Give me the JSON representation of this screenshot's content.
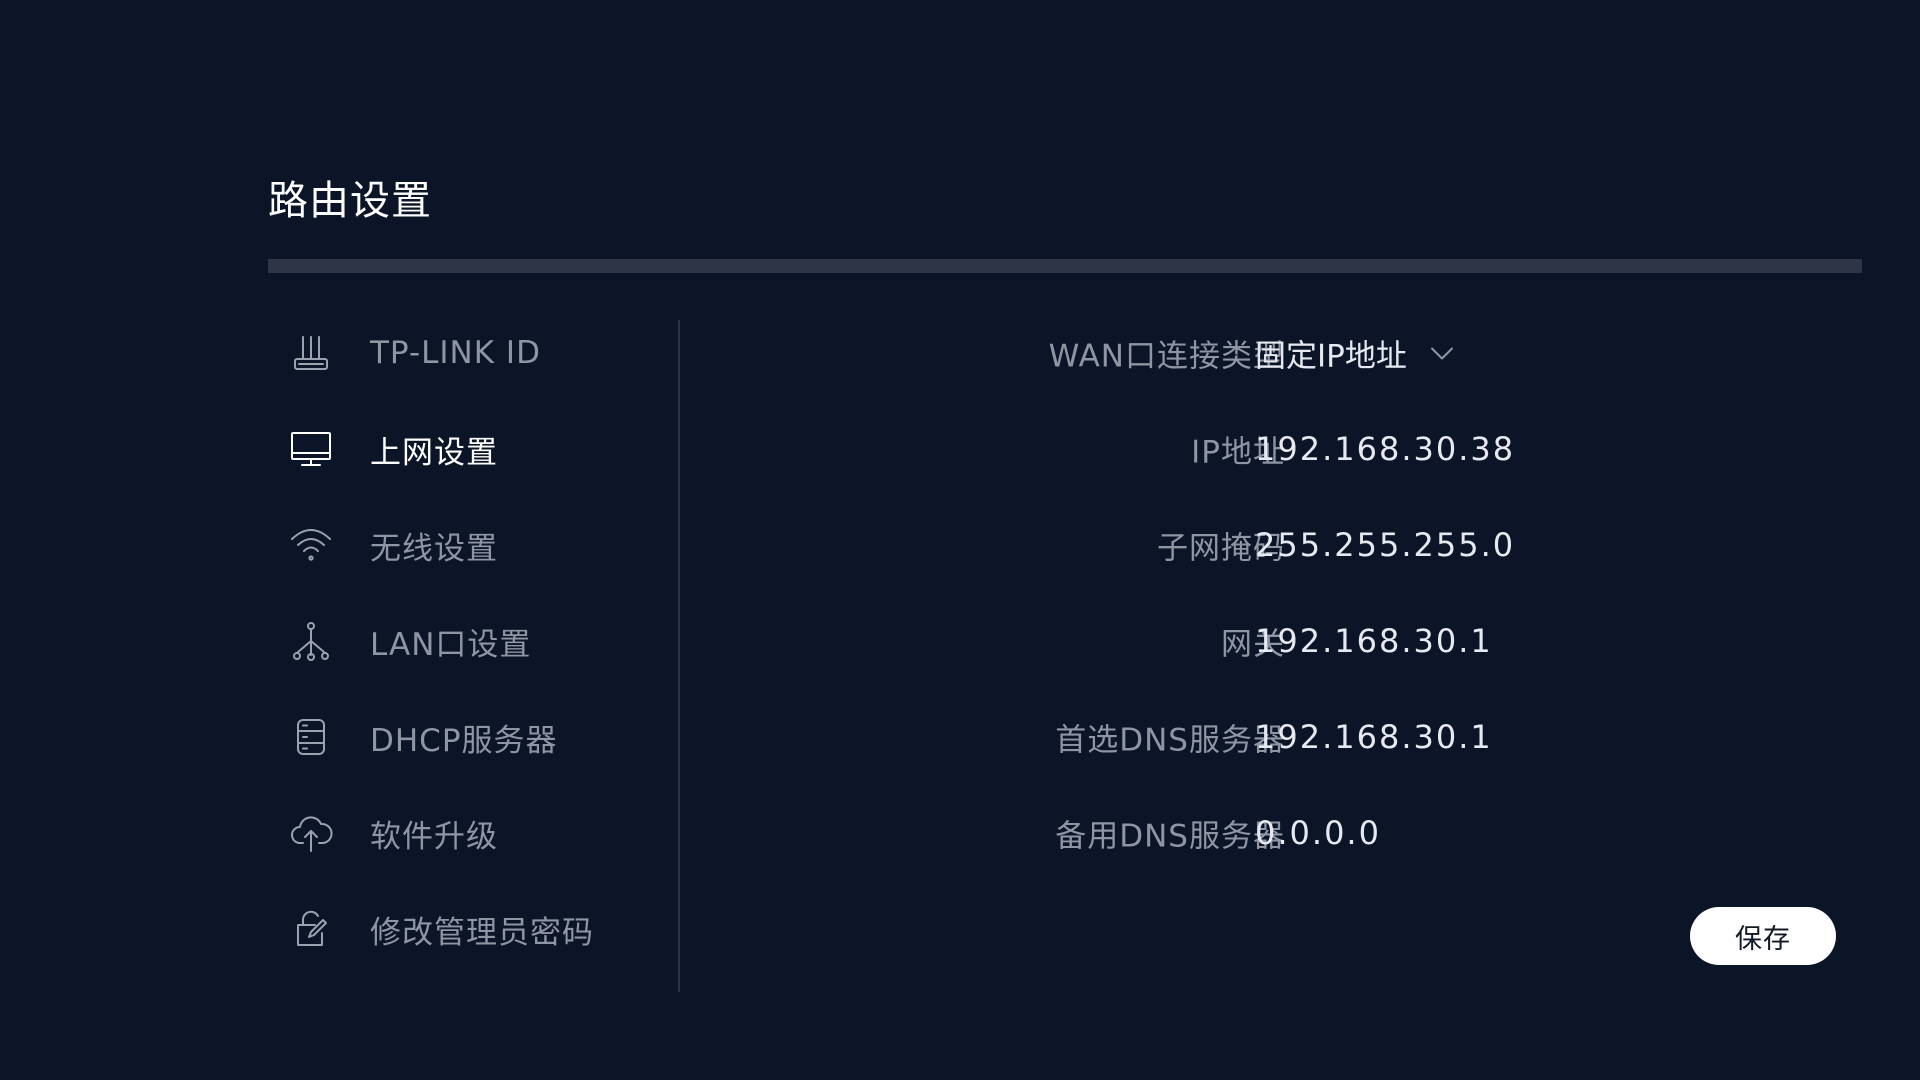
{
  "page": {
    "title": "路由设置"
  },
  "sidebar": {
    "items": [
      {
        "label": "TP-LINK ID",
        "icon": "router-icon",
        "active": false
      },
      {
        "label": "上网设置",
        "icon": "monitor-icon",
        "active": true
      },
      {
        "label": "无线设置",
        "icon": "wifi-icon",
        "active": false
      },
      {
        "label": "LAN口设置",
        "icon": "network-tree-icon",
        "active": false
      },
      {
        "label": "DHCP服务器",
        "icon": "server-icon",
        "active": false
      },
      {
        "label": "软件升级",
        "icon": "cloud-upload-icon",
        "active": false
      },
      {
        "label": "修改管理员密码",
        "icon": "lock-edit-icon",
        "active": false
      }
    ]
  },
  "form": {
    "wan_type": {
      "label": "WAN口连接类型",
      "value": "固定IP地址",
      "icon": "chevron-down-icon"
    },
    "ip_address": {
      "label": "IP地址",
      "value": "192.168.30.38"
    },
    "subnet_mask": {
      "label": "子网掩码",
      "value": "255.255.255.0"
    },
    "gateway": {
      "label": "网关",
      "value": "192.168.30.1"
    },
    "primary_dns": {
      "label": "首选DNS服务器",
      "value": "192.168.30.1"
    },
    "secondary_dns": {
      "label": "备用DNS服务器",
      "value": "0.0.0.0"
    }
  },
  "actions": {
    "save_label": "保存"
  },
  "colors": {
    "background": "#0c1427",
    "active_text": "#ffffff",
    "inactive_text": "#8e95a3",
    "divider": "#2a3243",
    "button_bg": "#ffffff"
  }
}
